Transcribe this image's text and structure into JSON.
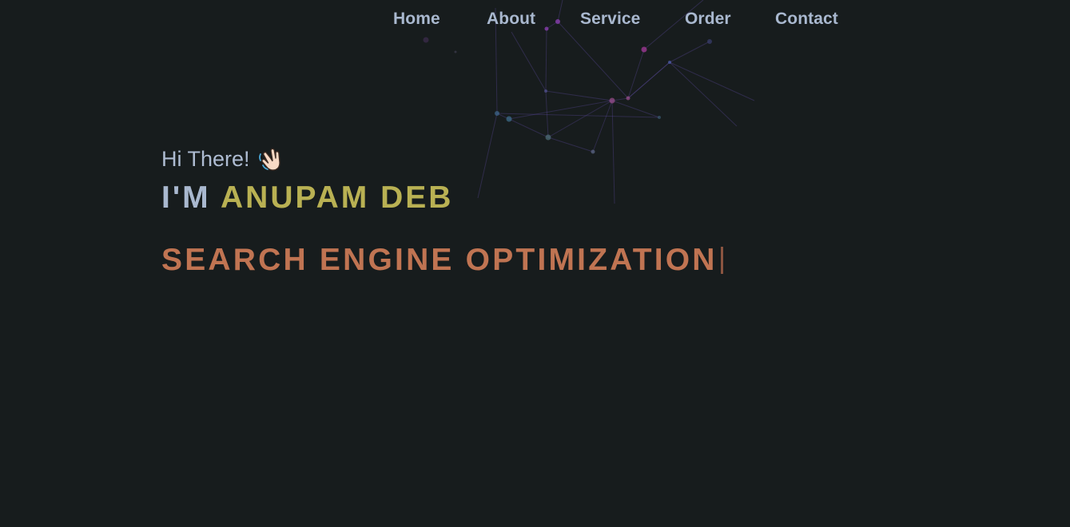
{
  "nav": {
    "items": [
      {
        "label": "Home"
      },
      {
        "label": "About"
      },
      {
        "label": "Service"
      },
      {
        "label": "Order"
      },
      {
        "label": "Contact"
      }
    ]
  },
  "hero": {
    "greeting": "Hi There!",
    "greeting_icon": "waving-hand-icon",
    "headline_prefix": "I'M",
    "name": "ANUPAM DEB",
    "typed_text": "SEARCH ENGINE OPTIMIZATION"
  },
  "colors": {
    "background": "#171c1d",
    "nav_text": "#a9b8cf",
    "name_accent": "#b9b153",
    "typed_accent": "#c07452"
  }
}
